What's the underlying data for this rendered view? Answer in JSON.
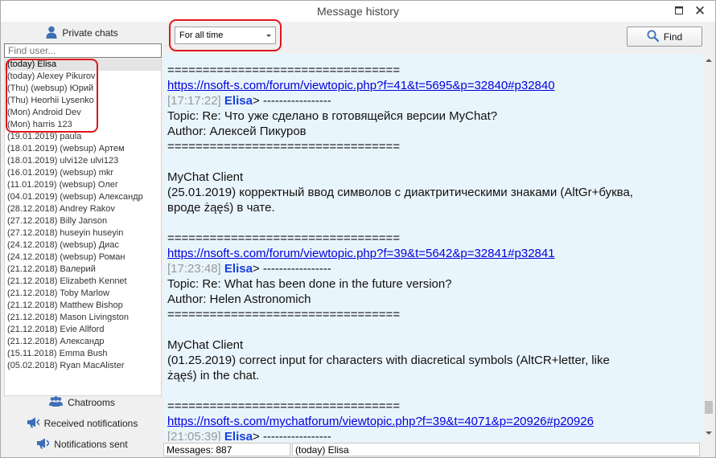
{
  "window": {
    "title": "Message history"
  },
  "left_panel": {
    "private_chats_label": "Private chats",
    "find_user_placeholder": "Find user...",
    "users": [
      "(today) Elisa",
      "(today) Alexey Pikurov",
      "(Thu) (websup) Юрий",
      "(Thu) Heorhii Lysenko",
      "(Mon) Android Dev",
      "(Mon) harris 123",
      "(19.01.2019) paula",
      "(18.01.2019) (websup) Артем",
      "(18.01.2019) ulvi12e ulvi123",
      "(16.01.2019) (websup) mkr",
      "(11.01.2019) (websup) Олег",
      "(04.01.2019) (websup) Александр",
      "(28.12.2018) Andrey Rakov",
      "(27.12.2018) Billy Janson",
      "(27.12.2018) huseyin huseyin",
      "(24.12.2018) (websup) Диас",
      "(24.12.2018) (websup) Роман",
      "(21.12.2018) Валерий",
      "(21.12.2018) Elizabeth Kennet",
      "(21.12.2018) Toby Marlow",
      "(21.12.2018) Matthew Bishop",
      "(21.12.2018) Mason Livingston",
      "(21.12.2018) Evie Allford",
      "(21.12.2018) Александр",
      "(15.11.2018) Emma Bush",
      "(05.02.2018) Ryan MacAlister"
    ],
    "selected_index": 0,
    "chatrooms_label": "Chatrooms",
    "received_notifications_label": "Received notifications",
    "notifications_sent_label": "Notifications sent"
  },
  "toolbar": {
    "period_value": "For all time",
    "find_label": "Find"
  },
  "messages": {
    "separator": "=================================",
    "short_separator": "=================================",
    "m1": {
      "link": "https://nsoft-s.com/forum/viewtopic.php?f=41&t=5695&p=32840#p32840",
      "time": "[17:17:22]",
      "author": "Elisa",
      "after_author": "> -----------------",
      "topic": "Topic:  Re: Что уже сделано в готовящейся версии MyChat?",
      "post_author": "Author: Алексей Пикуров",
      "client": "MyChat Client",
      "body1": " (25.01.2019) корректный ввод символов с диактритическими знаками (AltGr+буква,",
      "body2": "вроде żąęś) в чате."
    },
    "m2": {
      "link": "https://nsoft-s.com/forum/viewtopic.php?f=39&t=5642&p=32841#p32841",
      "time": "[17:23:48]",
      "author": "Elisa",
      "after_author": "> -----------------",
      "topic": "Topic:  Re: What has been done in the future version?",
      "post_author": "Author: Helen Astronomich",
      "client": "MyChat Client",
      "body1": " (01.25.2019) correct  input for characters with diacretical symbols (AltCR+letter, like",
      "body2": "żąęś) in the chat."
    },
    "m3": {
      "link": "https://nsoft-s.com/mychatforum/viewtopic.php?f=39&t=4071&p=20926#p20926",
      "time": "[21:05:39]",
      "author": "Elisa",
      "after_author": "> -----------------"
    }
  },
  "status": {
    "messages_count": "Messages: 887",
    "current_user": "(today) Elisa"
  },
  "colors": {
    "highlight_red": "#e0161c",
    "message_bg": "#e9f5fc",
    "link_blue": "#0000dd",
    "author_blue": "#1a3fd6"
  }
}
